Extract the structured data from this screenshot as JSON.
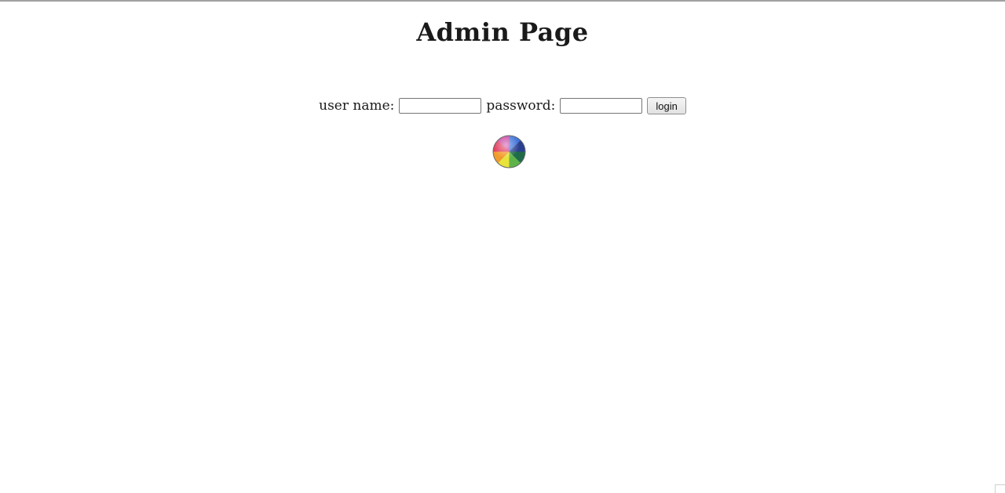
{
  "header": {
    "title": "Admin Page"
  },
  "login_form": {
    "username_label": "user name:",
    "username_value": "",
    "password_label": "password:",
    "password_value": "",
    "login_button_label": "login"
  },
  "icons": {
    "loading": "loading-spinner-icon",
    "resize": "resize-grip-icon"
  },
  "colors": {
    "title_text": "#1a1a1a",
    "background": "#ffffff"
  }
}
